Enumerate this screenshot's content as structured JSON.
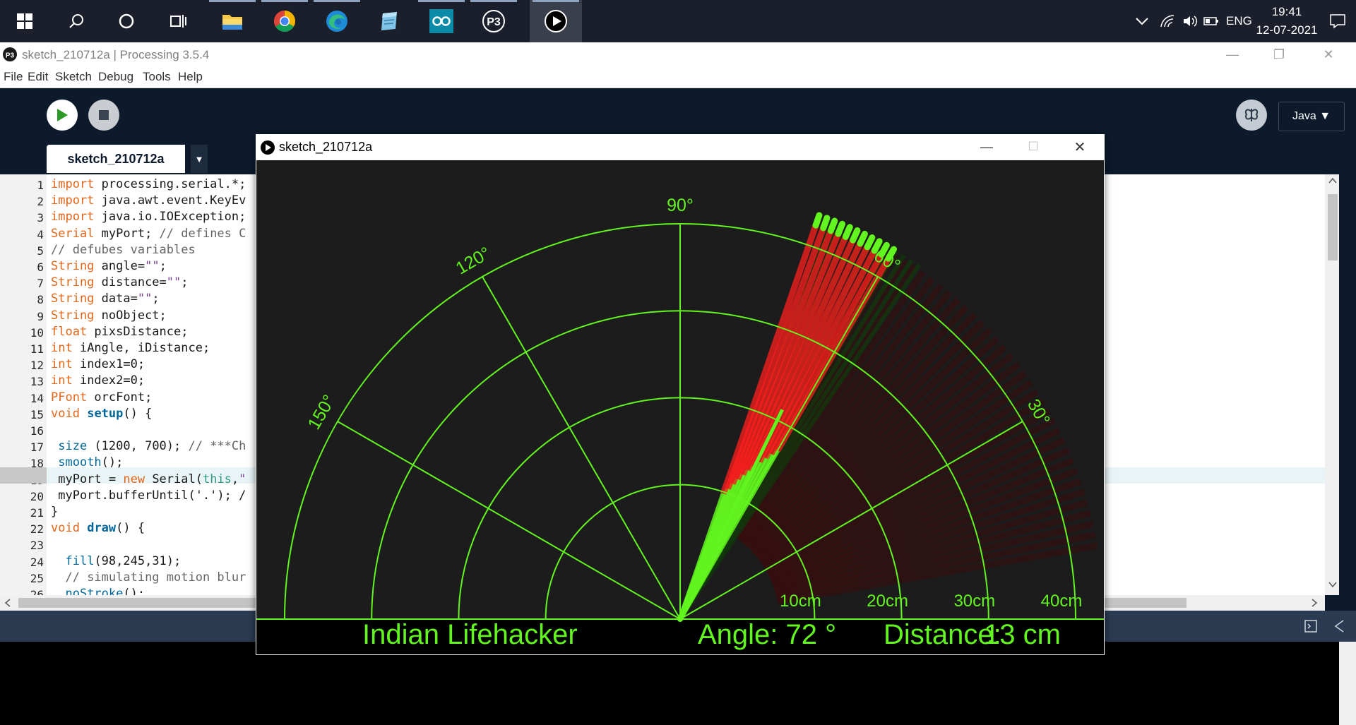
{
  "taskbar": {
    "icons": [
      "windows-start-icon",
      "search-icon",
      "cortana-icon",
      "task-view-icon"
    ],
    "apps": [
      "file-explorer-icon",
      "chrome-icon",
      "edge-icon",
      "notepad-icon",
      "arduino-icon",
      "processing-icon",
      "processing-sketch-icon"
    ],
    "tray": {
      "language": "ENG",
      "time": "19:41",
      "date": "12-07-2021"
    }
  },
  "ide": {
    "title": "sketch_210712a | Processing 3.5.4",
    "menu": [
      "File",
      "Edit",
      "Sketch",
      "Debug",
      "Tools",
      "Help"
    ],
    "mode": "Java ▼",
    "tab_label": "sketch_210712a",
    "tab_arrow": "▼",
    "highlighted_line": 19,
    "code_lines": [
      "import processing.serial.*;",
      "import java.awt.event.KeyEv",
      "import java.io.IOException;",
      "Serial myPort; // defines C",
      "// defubes variables",
      "String angle=\"\";",
      "String distance=\"\";",
      "String data=\"\";",
      "String noObject;",
      "float pixsDistance;",
      "int iAngle, iDistance;",
      "int index1=0;",
      "int index2=0;",
      "PFont orcFont;",
      "void setup() {",
      "",
      " size (1200, 700); // ***Ch",
      " smooth();",
      " myPort = new Serial(this,\"",
      " myPort.bufferUntil('.'); /",
      "}",
      "void draw() {",
      "",
      "  fill(98,245,31);",
      "  // simulating motion blur",
      "  noStroke();"
    ]
  },
  "sketch": {
    "title": "sketch_210712a",
    "angle_labels": [
      "30°",
      "60°",
      "90°",
      "120°",
      "150°"
    ],
    "distance_labels": [
      "10cm",
      "20cm",
      "30cm",
      "40cm"
    ],
    "footer_name": "Indian Lifehacker",
    "footer_angle": "Angle: 72 °",
    "footer_distance": "Distance:",
    "footer_distance_value": "13 cm",
    "current_angle": 72,
    "colors": {
      "radar_green": "#62f51f",
      "object_red": "#ff1e1e",
      "bg": "#1c1c1c"
    }
  }
}
